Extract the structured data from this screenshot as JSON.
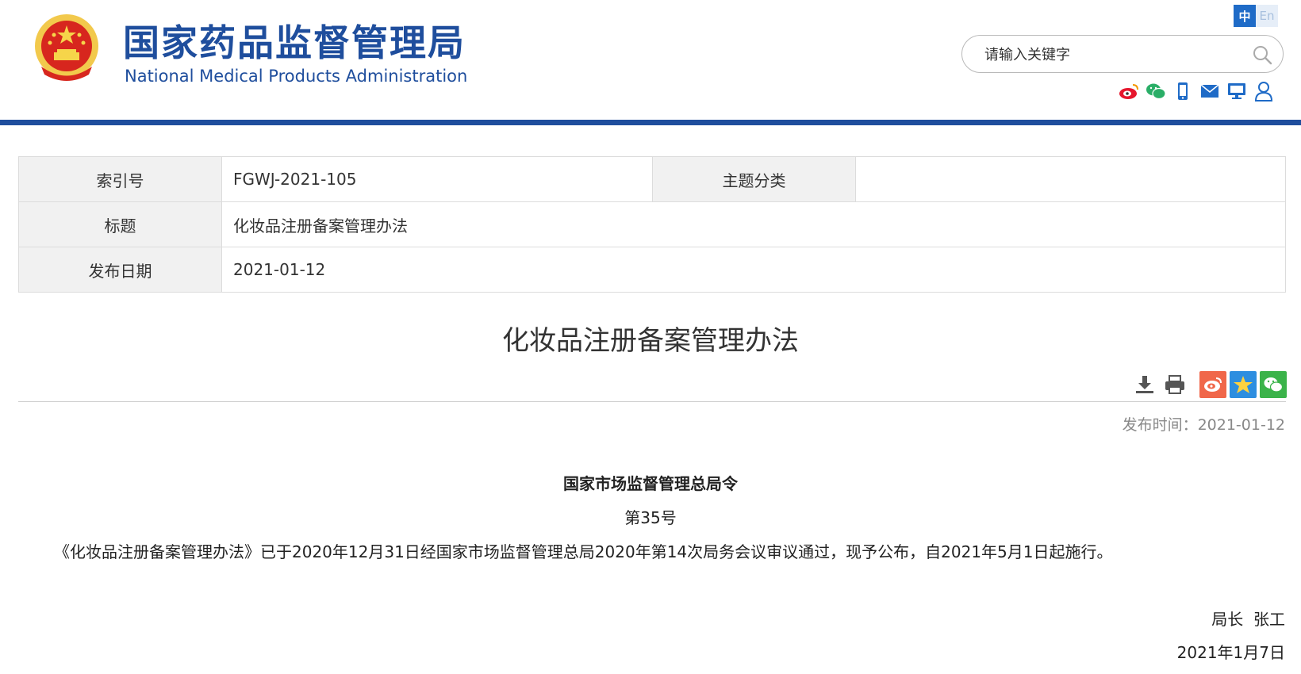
{
  "header": {
    "title": "国家药品监督管理局",
    "subtitle": "National Medical Products Administration",
    "lang": {
      "zh": "中",
      "en": "En"
    },
    "search": {
      "placeholder": "请输入关键字"
    },
    "social_icons": [
      "weibo-icon",
      "wechat-icon",
      "mobile-icon",
      "mail-icon",
      "monitor-icon",
      "user-icon"
    ],
    "brand_color": "#1f4e9d"
  },
  "info": {
    "index_label": "索引号",
    "index_value": "FGWJ-2021-105",
    "topic_label": "主题分类",
    "topic_value": "",
    "title_label": "标题",
    "title_value": "化妆品注册备案管理办法",
    "date_label": "发布日期",
    "date_value": "2021-01-12"
  },
  "article": {
    "title": "化妆品注册备案管理办法",
    "tools": [
      "download-icon",
      "print-icon",
      "weibo-share-icon",
      "favorite-icon",
      "wechat-share-icon"
    ],
    "publish_time": "发布时间：2021-01-12",
    "heading": "国家市场监督管理总局令",
    "number": "第35号",
    "body": "《化妆品注册备案管理办法》已于2020年12月31日经国家市场监督管理总局2020年第14次局务会议审议通过，现予公布，自2021年5月1日起施行。",
    "signer": "局长  张工",
    "date": "2021年1月7日"
  }
}
